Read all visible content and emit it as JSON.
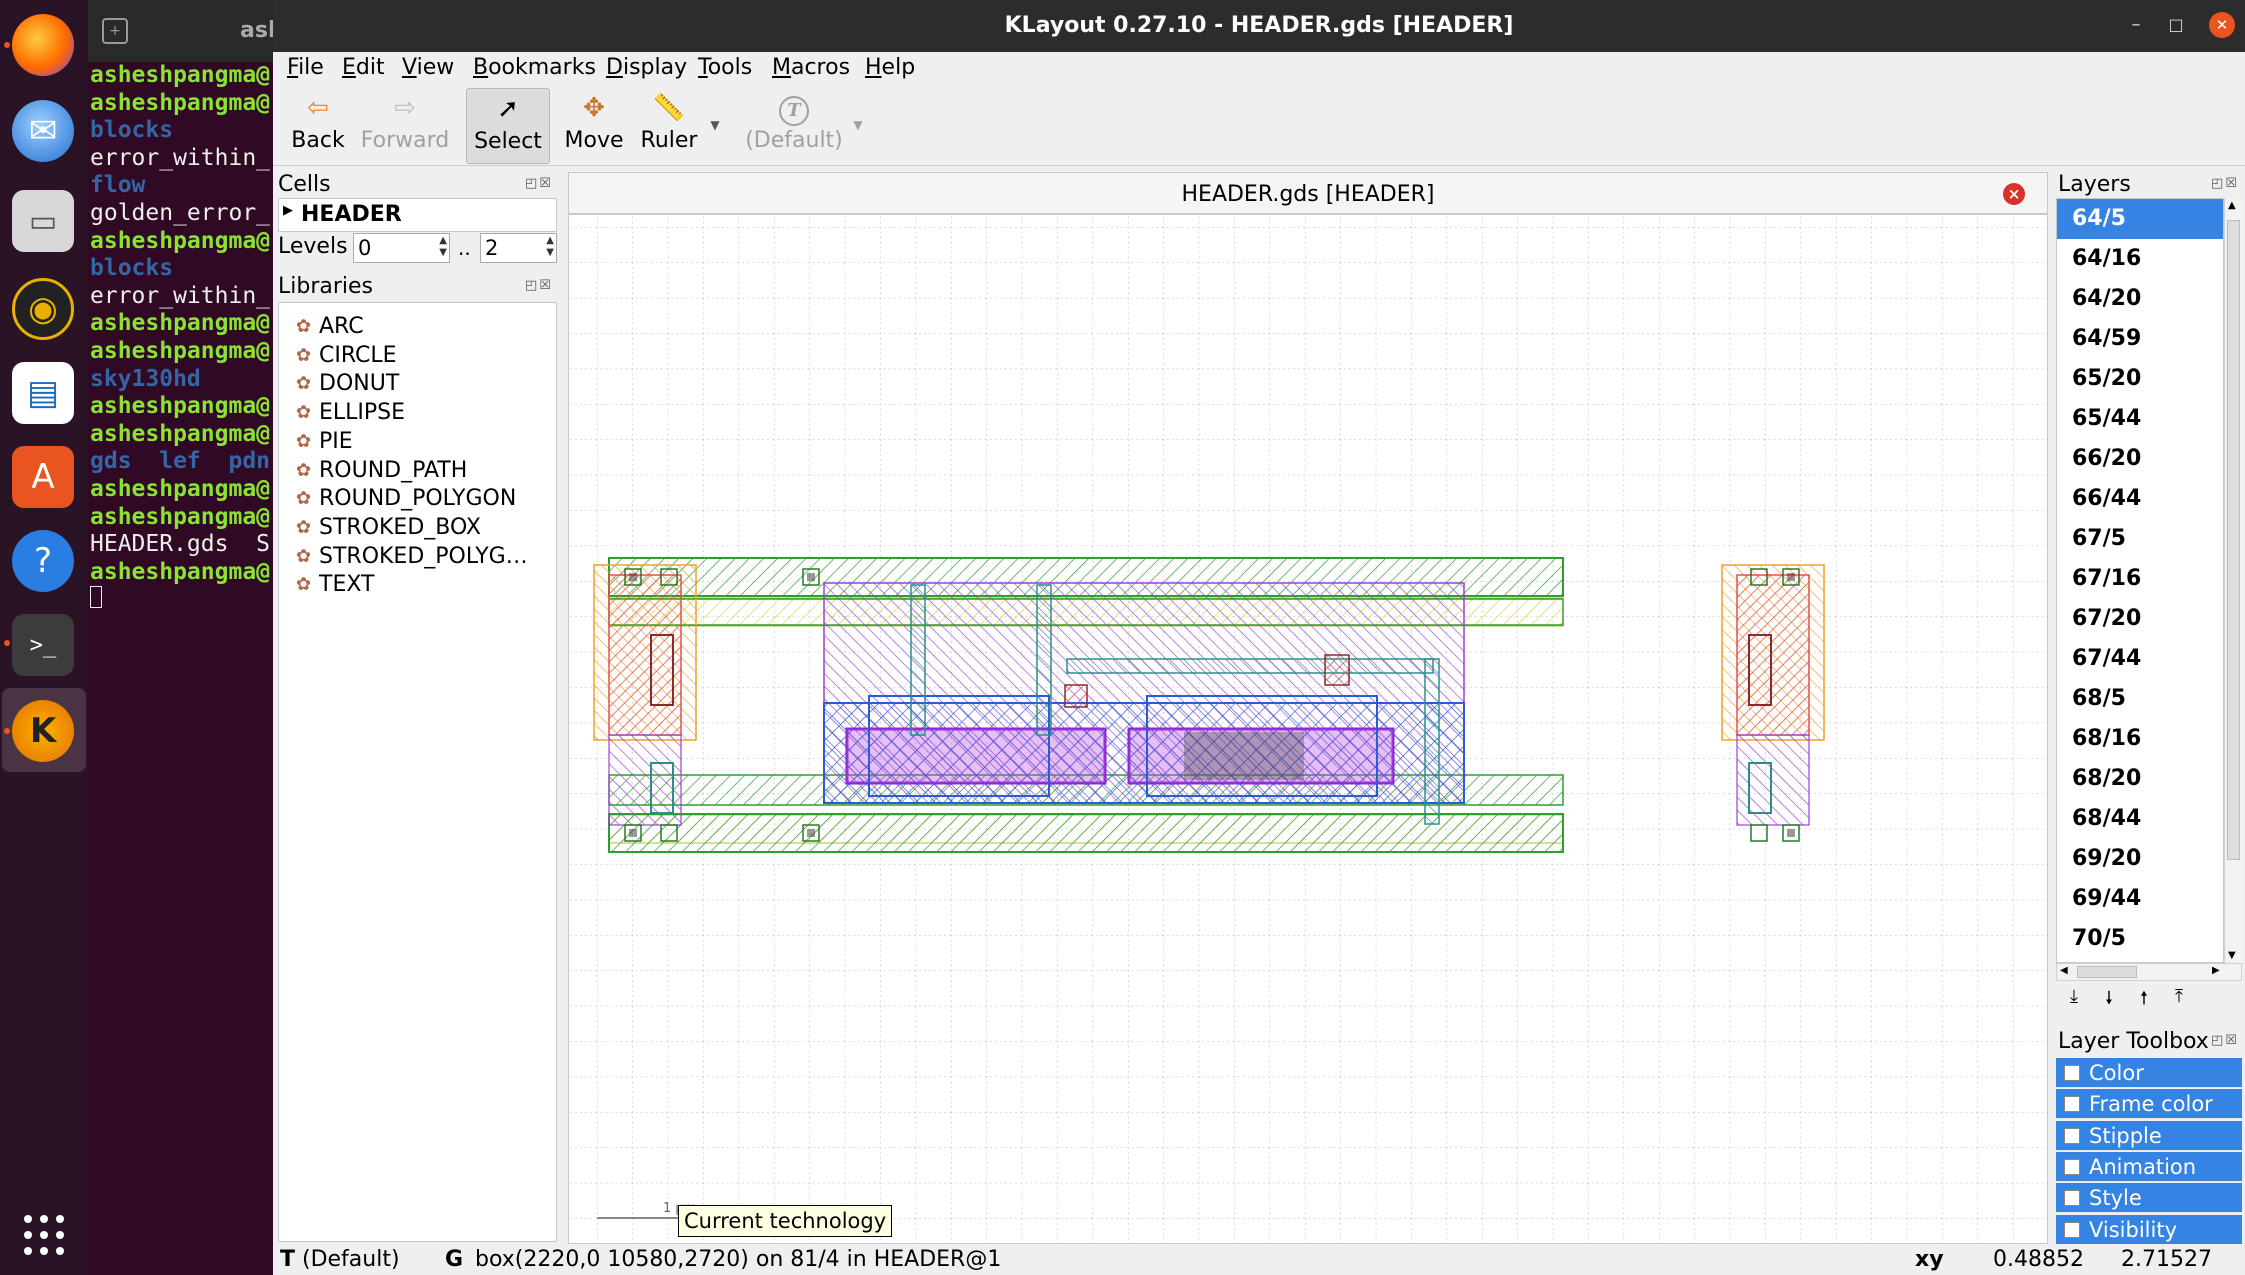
{
  "window": {
    "title": "KLayout 0.27.10 - HEADER.gds [HEADER]",
    "minimize": "–",
    "maximize": "□",
    "close": "✕"
  },
  "menu": [
    "File",
    "Edit",
    "View",
    "Bookmarks",
    "Display",
    "Tools",
    "Macros",
    "Help"
  ],
  "toolbar": {
    "back": "Back",
    "forward": "Forward",
    "select": "Select",
    "move": "Move",
    "ruler": "Ruler",
    "default": "(Default)"
  },
  "cells": {
    "title": "Cells",
    "root": "HEADER",
    "levels_label": "Levels",
    "level_from": "0",
    "level_sep": "..",
    "level_to": "2"
  },
  "libraries": {
    "title": "Libraries",
    "items": [
      "ARC",
      "CIRCLE",
      "DONUT",
      "ELLIPSE",
      "PIE",
      "ROUND_PATH",
      "ROUND_POLYGON",
      "STROKED_BOX",
      "STROKED_POLYG…",
      "TEXT"
    ]
  },
  "view": {
    "tab_title": "HEADER.gds [HEADER]",
    "scale_label": "1 µm"
  },
  "layers": {
    "title": "Layers",
    "items": [
      "64/5",
      "64/16",
      "64/20",
      "64/59",
      "65/20",
      "65/44",
      "66/20",
      "66/44",
      "67/5",
      "67/16",
      "67/20",
      "67/44",
      "68/5",
      "68/16",
      "68/20",
      "68/44",
      "69/20",
      "69/44",
      "70/5"
    ],
    "selected_index": 0
  },
  "layer_toolbox": {
    "title": "Layer Toolbox",
    "items": [
      "Color",
      "Frame color",
      "Stipple",
      "Animation",
      "Style",
      "Visibility"
    ]
  },
  "status": {
    "tool": "T",
    "tech": "(Default)",
    "grid": "G",
    "message": "box(2220,0 10580,2720) on 81/4 in HEADER@1",
    "coord_label": "xy",
    "x": "0.48852",
    "y": "2.71527"
  },
  "tooltip": "Current technology",
  "terminal": {
    "tab_title": "ash",
    "lines": [
      {
        "t": "asheshpangma@",
        "c": "green"
      },
      {
        "t": "asheshpangma@",
        "c": "green"
      },
      {
        "t": "blocks",
        "c": "blue"
      },
      {
        "t": "error_within_",
        "c": "white"
      },
      {
        "t": "flow",
        "c": "blue"
      },
      {
        "t": "golden_error_",
        "c": "white"
      },
      {
        "t": "asheshpangma@",
        "c": "green"
      },
      {
        "t": "blocks",
        "c": "blue"
      },
      {
        "t": "error_within_",
        "c": "white"
      },
      {
        "t": "asheshpangma@",
        "c": "green"
      },
      {
        "t": "asheshpangma@",
        "c": "green"
      },
      {
        "t": "sky130hd",
        "c": "blue"
      },
      {
        "t": "asheshpangma@",
        "c": "green"
      },
      {
        "t": "asheshpangma@",
        "c": "green"
      },
      {
        "t": "gds  lef  pdn",
        "c": "mixed"
      },
      {
        "t": "asheshpangma@",
        "c": "green"
      },
      {
        "t": "asheshpangma@",
        "c": "green"
      },
      {
        "t": "HEADER.gds  S",
        "c": "white"
      },
      {
        "t": "asheshpangma@",
        "c": "green"
      }
    ]
  },
  "colors": {
    "accent": "#3584e4",
    "dock": "#2b1326",
    "terminal_bg": "#300a24"
  }
}
